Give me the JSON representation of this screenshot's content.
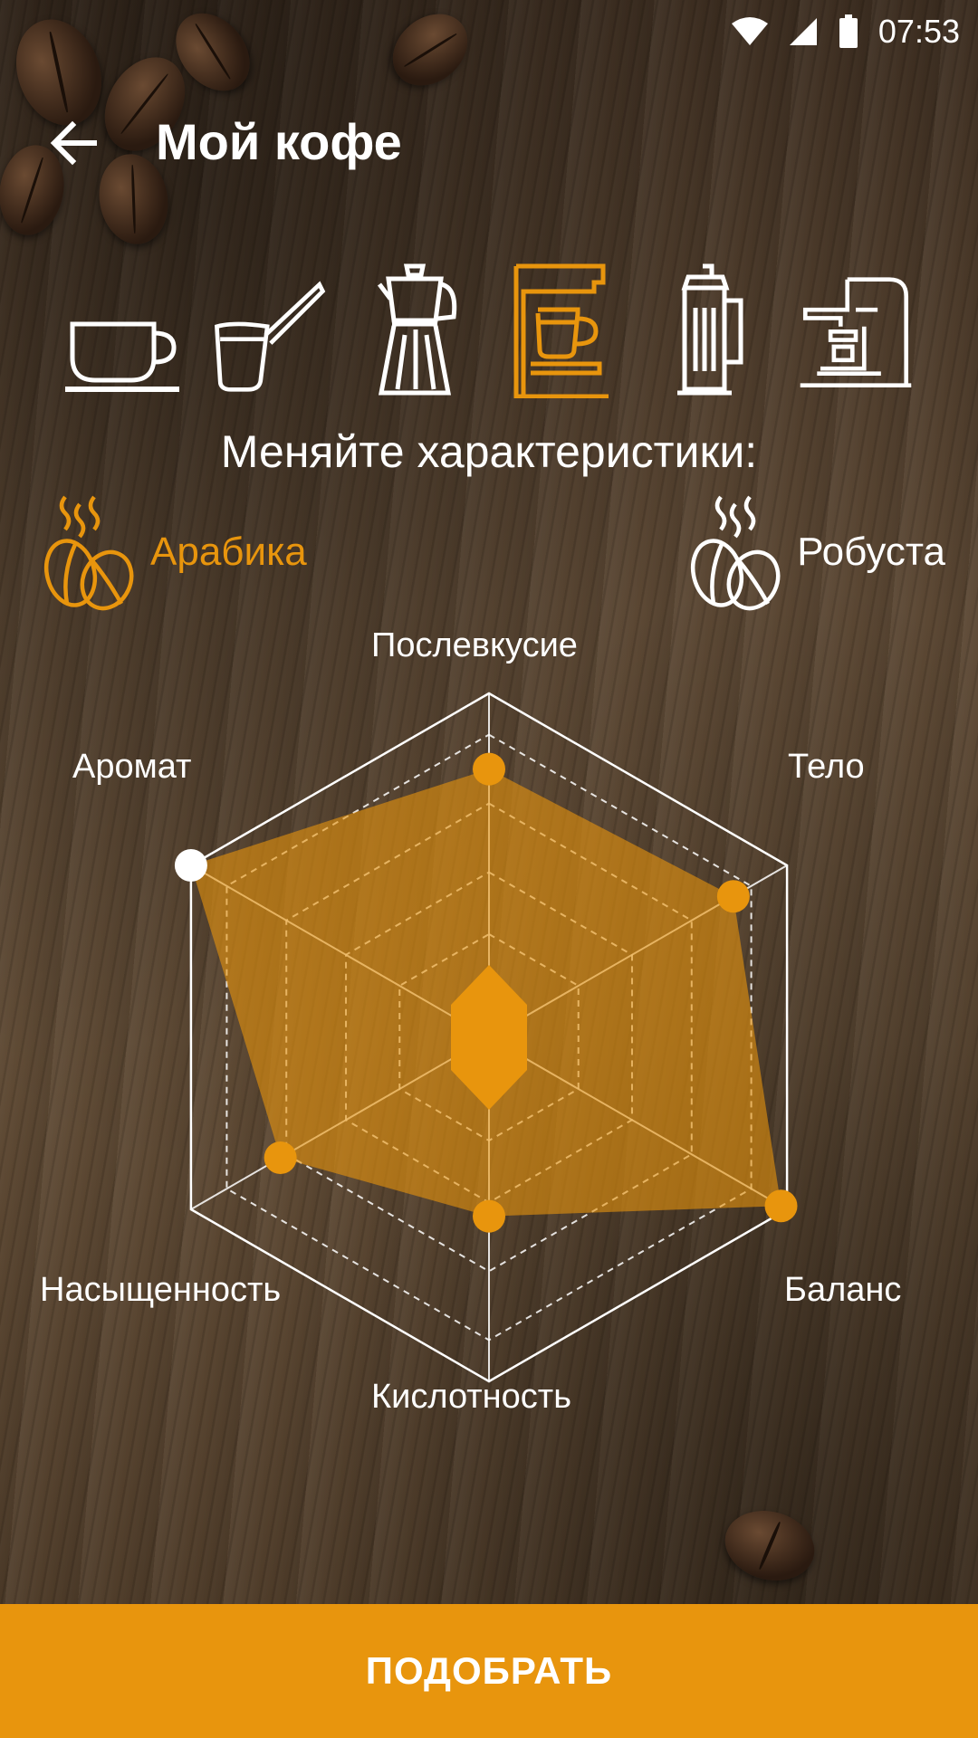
{
  "status_bar": {
    "time": "07:53"
  },
  "app_bar": {
    "title": "Мой кофе"
  },
  "brew_methods": {
    "items": [
      {
        "icon": "cup-icon",
        "selected": false
      },
      {
        "icon": "cezve-icon",
        "selected": false
      },
      {
        "icon": "moka-pot-icon",
        "selected": false
      },
      {
        "icon": "drip-coffee-maker-icon",
        "selected": true
      },
      {
        "icon": "french-press-icon",
        "selected": false
      },
      {
        "icon": "espresso-machine-icon",
        "selected": false
      }
    ]
  },
  "subtitle": "Меняйте характеристики:",
  "bean_types": {
    "arabica": {
      "label": "Арабика",
      "selected": true
    },
    "robusta": {
      "label": "Робуста",
      "selected": false
    }
  },
  "radar": {
    "axes": [
      "Послевкусие",
      "Тело",
      "Баланс",
      "Кислотность",
      "Насыщенность",
      "Аромат"
    ],
    "values": [
      0.78,
      0.82,
      0.98,
      0.52,
      0.7,
      1.0
    ],
    "active_index": 5
  },
  "colors": {
    "accent": "#e8950d",
    "line": "#ffffff"
  },
  "cta": {
    "label": "ПОДОБРАТЬ"
  }
}
